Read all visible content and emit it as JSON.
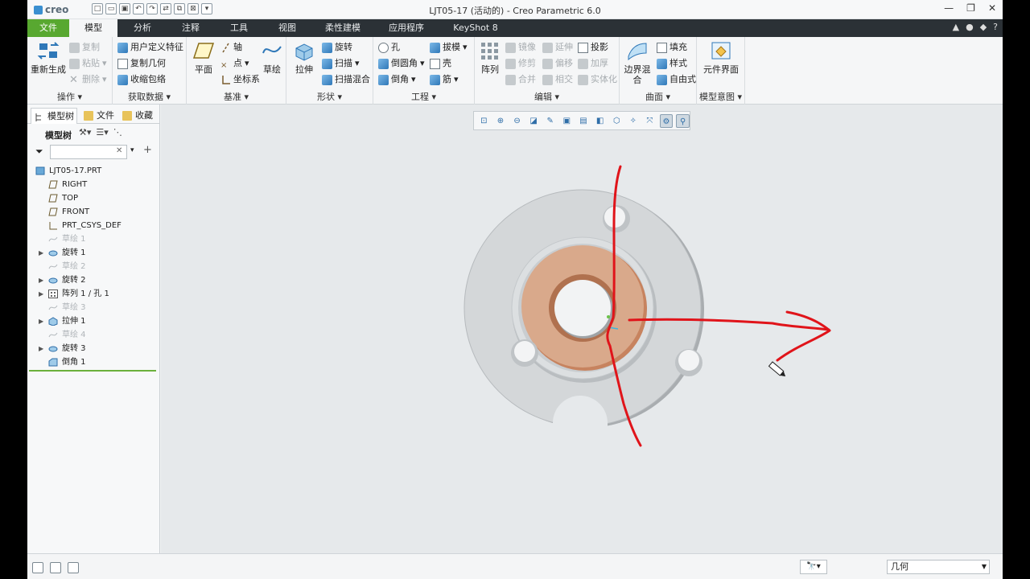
{
  "app": {
    "logo_text": "creo",
    "window_title": "LJT05-17 (活动的) - Creo Parametric 6.0"
  },
  "quick_access": [
    "新建",
    "打开",
    "保存",
    "撤消",
    "重做",
    "重新生成",
    "窗口",
    "关闭"
  ],
  "window_controls": {
    "minimize": "—",
    "restore": "❐",
    "close": "✕"
  },
  "tabs": [
    {
      "label": "文件",
      "kind": "file"
    },
    {
      "label": "模型",
      "kind": "active"
    },
    {
      "label": "分析",
      "kind": ""
    },
    {
      "label": "注释",
      "kind": ""
    },
    {
      "label": "工具",
      "kind": ""
    },
    {
      "label": "视图",
      "kind": ""
    },
    {
      "label": "柔性建模",
      "kind": ""
    },
    {
      "label": "应用程序",
      "kind": ""
    },
    {
      "label": "KeyShot 8",
      "kind": ""
    }
  ],
  "tab_right_icons": [
    "▲",
    "●",
    "◆",
    "?"
  ],
  "ribbon": {
    "operations": {
      "label": "操作",
      "regenerate": "重新生成",
      "copy": "复制",
      "paste": "粘贴",
      "delete": "删除"
    },
    "get_data": {
      "label": "获取数据",
      "udf": "用户定义特征",
      "copy_geom": "复制几何",
      "shrinkwrap": "收缩包络"
    },
    "datum": {
      "label": "基准",
      "plane": "平面",
      "axis": "轴",
      "point": "点",
      "csys": "坐标系",
      "sketch": "草绘"
    },
    "shapes": {
      "label": "形状",
      "extrude": "拉伸",
      "revolve": "旋转",
      "sweep": "扫描",
      "swept_blend": "扫描混合"
    },
    "engineering": {
      "label": "工程",
      "hole": "孔",
      "round": "倒圆角",
      "chamfer": "倒角",
      "draft": "拔模",
      "shell": "壳",
      "rib": "筋"
    },
    "editing": {
      "label": "编辑",
      "pattern": "阵列",
      "mirror": "镜像",
      "trim": "修剪",
      "merge": "合并",
      "extend": "延伸",
      "offset": "偏移",
      "intersect": "相交",
      "project": "投影",
      "thicken": "加厚",
      "solidify": "实体化"
    },
    "surfaces": {
      "label": "曲面",
      "boundary_blend": "边界混合",
      "fill": "填充",
      "style": "样式",
      "freestyle": "自由式"
    },
    "model_intent": {
      "label": "模型意图",
      "component_interface": "元件界面"
    }
  },
  "left_panel": {
    "tabs": [
      "模型树",
      "文件",
      "收藏"
    ],
    "tree_label": "模型树",
    "filter_placeholder": "",
    "nodes": [
      {
        "label": "LJT05-17.PRT",
        "icon": "part-icon",
        "expandable": false,
        "dim": false,
        "root": true
      },
      {
        "label": "RIGHT",
        "icon": "datum-plane-icon",
        "expandable": false,
        "dim": false
      },
      {
        "label": "TOP",
        "icon": "datum-plane-icon",
        "expandable": false,
        "dim": false
      },
      {
        "label": "FRONT",
        "icon": "datum-plane-icon",
        "expandable": false,
        "dim": false
      },
      {
        "label": "PRT_CSYS_DEF",
        "icon": "csys-icon",
        "expandable": false,
        "dim": false
      },
      {
        "label": "草绘 1",
        "icon": "sketch-icon",
        "expandable": false,
        "dim": true
      },
      {
        "label": "旋转 1",
        "icon": "revolve-icon",
        "expandable": true,
        "dim": false
      },
      {
        "label": "草绘 2",
        "icon": "sketch-icon",
        "expandable": false,
        "dim": true
      },
      {
        "label": "旋转 2",
        "icon": "revolve-icon",
        "expandable": true,
        "dim": false
      },
      {
        "label": "阵列 1 / 孔 1",
        "icon": "pattern-icon",
        "expandable": true,
        "dim": false
      },
      {
        "label": "草绘 3",
        "icon": "sketch-icon",
        "expandable": false,
        "dim": true
      },
      {
        "label": "拉伸 1",
        "icon": "extrude-icon",
        "expandable": true,
        "dim": false
      },
      {
        "label": "草绘 4",
        "icon": "sketch-icon",
        "expandable": false,
        "dim": true
      },
      {
        "label": "旋转 3",
        "icon": "revolve-icon",
        "expandable": true,
        "dim": false
      },
      {
        "label": "倒角 1",
        "icon": "chamfer-icon",
        "expandable": false,
        "dim": false
      }
    ]
  },
  "status_bar": {
    "selection_filter": "几何"
  },
  "colors": {
    "file_tab": "#58a830",
    "tab_bar": "#2b3136",
    "part_gray": "#d4d7d9",
    "highlight_face": "#d9a98b",
    "annotation_red": "#e0141a"
  }
}
